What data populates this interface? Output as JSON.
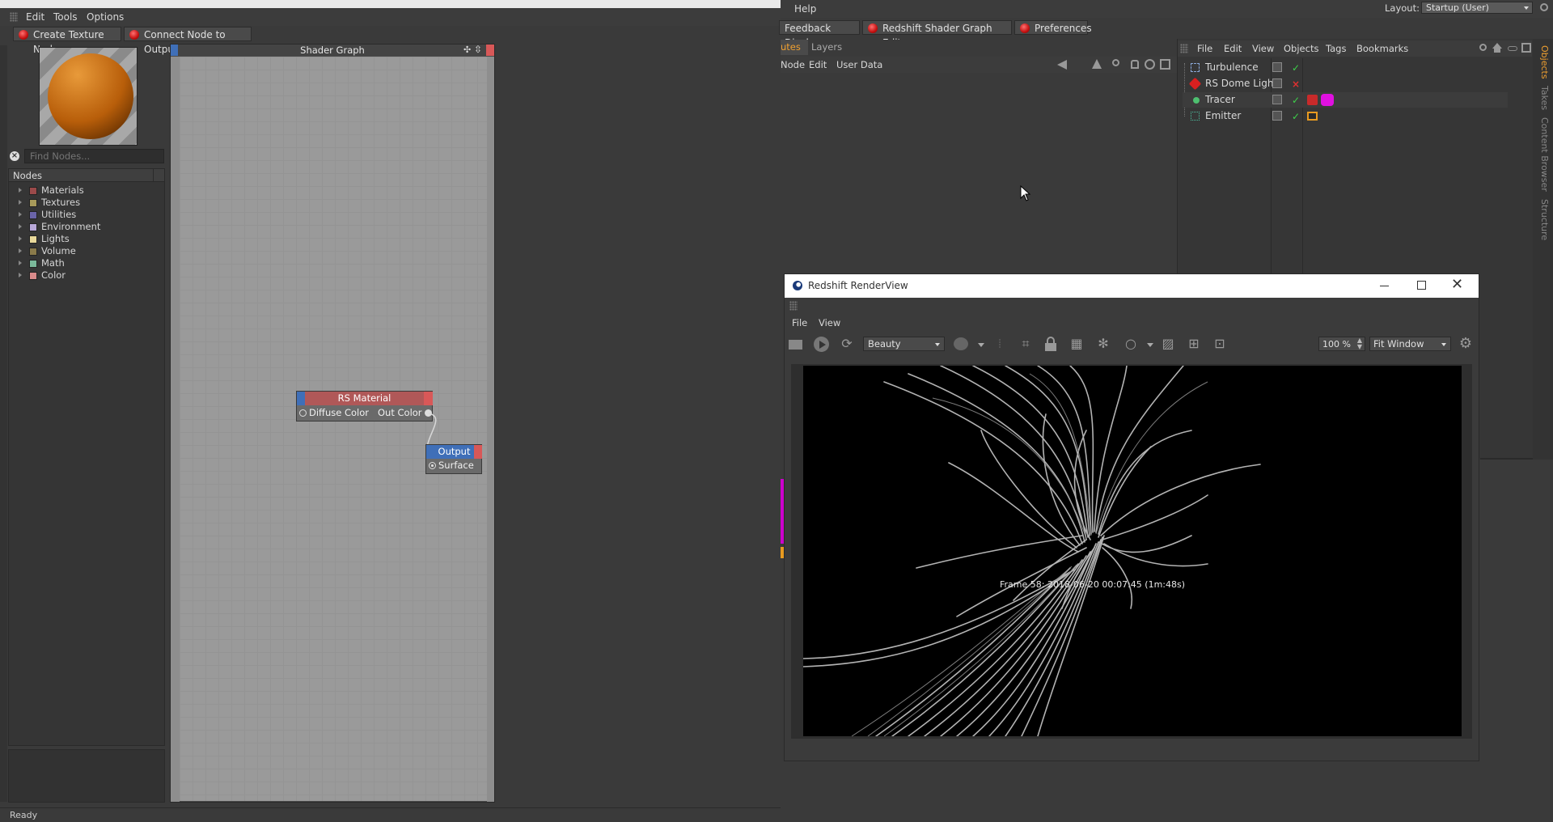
{
  "main_menu": {
    "help": "Help",
    "layout_label": "Layout:",
    "layout_value": "Startup (User)"
  },
  "shader_editor": {
    "menu": [
      "Edit",
      "Tools",
      "Options"
    ],
    "buttons": {
      "create_texture": "Create Texture Node",
      "connect_output": "Connect Node to Output"
    },
    "graph_title": "Shader Graph",
    "search_placeholder": "Find Nodes...",
    "tree_header": "Nodes",
    "categories": [
      {
        "label": "Materials",
        "color": "#9b4a4a"
      },
      {
        "label": "Textures",
        "color": "#a89a5a"
      },
      {
        "label": "Utilities",
        "color": "#6a64a8"
      },
      {
        "label": "Environment",
        "color": "#b8a8d8"
      },
      {
        "label": "Lights",
        "color": "#e8d89a"
      },
      {
        "label": "Volume",
        "color": "#8a7a4a"
      },
      {
        "label": "Math",
        "color": "#7ab89a"
      },
      {
        "label": "Color",
        "color": "#d88a8a"
      }
    ],
    "nodes": {
      "material": {
        "title": "RS Material",
        "in_port": "Diffuse Color",
        "out_port": "Out Color"
      },
      "output": {
        "title": "Output",
        "in_port": "Surface"
      }
    },
    "status": "Ready"
  },
  "toolbar_tabs": {
    "feedback": "Feedback Display",
    "shader_graph": "Redshift Shader Graph Editor",
    "preferences": "Preferences"
  },
  "attributes": {
    "tabs": [
      "utes",
      "Layers"
    ],
    "menu": [
      "Node",
      "Edit",
      "User Data"
    ]
  },
  "objects": {
    "menu": [
      "File",
      "Edit",
      "View",
      "Objects",
      "Tags",
      "Bookmarks"
    ],
    "items": [
      {
        "name": "Turbulence",
        "status": "ok"
      },
      {
        "name": "RS Dome Light",
        "status": "off"
      },
      {
        "name": "Tracer",
        "status": "ok"
      },
      {
        "name": "Emitter",
        "status": "ok"
      }
    ],
    "side_tabs": [
      "Objects",
      "Takes",
      "Content Browser",
      "Structure"
    ]
  },
  "renderview": {
    "title": "Redshift RenderView",
    "menu": [
      "File",
      "View"
    ],
    "aov": "Beauty",
    "zoom": "100 %",
    "fit": "Fit Window",
    "frame_info": "Frame 58: 2018-06-20 00:07:45 (1m:48s)"
  }
}
